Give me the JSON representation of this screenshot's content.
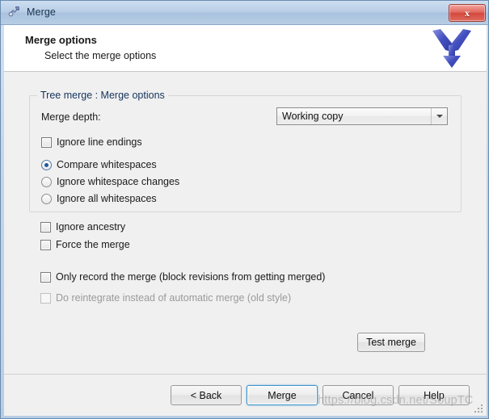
{
  "window": {
    "title": "Merge",
    "app_icon": "merge-app-icon",
    "close_label": "x"
  },
  "header": {
    "title": "Merge options",
    "subtitle": "Select the merge options",
    "logo": "merge-arrow-logo"
  },
  "groupbox": {
    "legend": "Tree merge : Merge options",
    "merge_depth_label": "Merge depth:",
    "merge_depth_value": "Working copy",
    "merge_depth_options": [
      "Working copy"
    ],
    "checkbox_ignore_line_endings": {
      "label": "Ignore line endings",
      "checked": false,
      "enabled": true
    },
    "whitespace_radios": [
      {
        "label": "Compare whitespaces",
        "checked": true
      },
      {
        "label": "Ignore whitespace changes",
        "checked": false
      },
      {
        "label": "Ignore all whitespaces",
        "checked": false
      }
    ]
  },
  "options": [
    {
      "label": "Ignore ancestry",
      "checked": false,
      "enabled": true
    },
    {
      "label": "Force the merge",
      "checked": false,
      "enabled": true
    },
    {
      "label": "Only record the merge (block revisions from getting merged)",
      "checked": false,
      "enabled": true
    },
    {
      "label": "Do reintegrate instead of automatic merge (old style)",
      "checked": false,
      "enabled": false
    }
  ],
  "buttons": {
    "test_merge": "Test merge",
    "back": "< Back",
    "merge": "Merge",
    "cancel": "Cancel",
    "help": "Help"
  },
  "watermark": "https://blog.csdn.net/SoupTC",
  "colors": {
    "titlebar": "#b8cde6",
    "accent_focus": "#3c93c9",
    "close_button": "#d4493e",
    "logo_blue": "#4450c0",
    "content_bg": "#f0f0f0",
    "legend_text": "#14335c"
  }
}
